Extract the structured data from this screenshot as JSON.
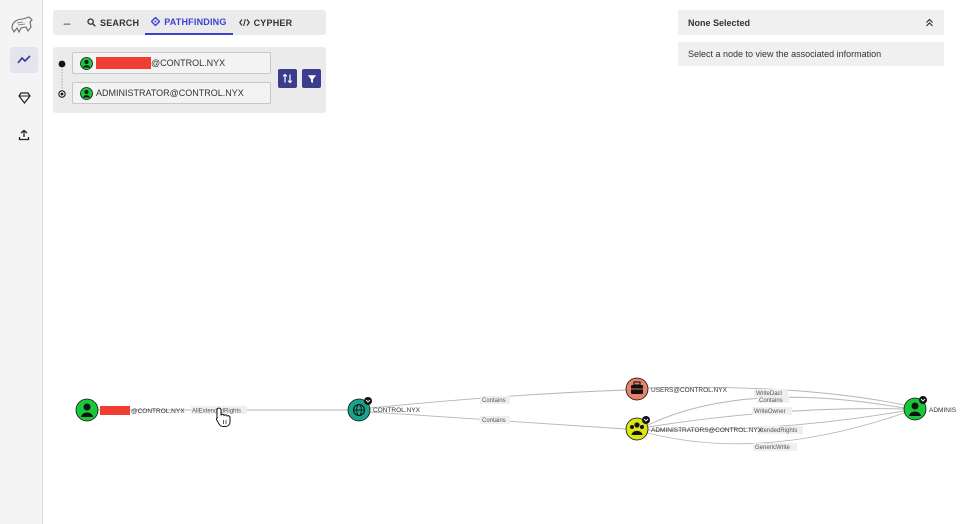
{
  "tabs": {
    "collapse": "–",
    "search": "SEARCH",
    "pathfinding": "PATHFINDING",
    "cypher": "CYPHER"
  },
  "pathfinding": {
    "source_suffix": "@CONTROL.NYX",
    "target_value": "ADMINISTRATOR@CONTROL.NYX"
  },
  "info_panel": {
    "title": "None Selected",
    "message": "Select a node to view the associated information"
  },
  "graph": {
    "nodes": {
      "source_suffix": "@CONTROL.NYX",
      "domain": "CONTROL.NYX",
      "users_group": "USERS@CONTROL.NYX",
      "admins_group": "ADMINISTRATORS@CONTROL.NYX",
      "admin_user": "ADMINIS"
    },
    "edges": {
      "e1": "AllExtendedRights",
      "e2": "Contains",
      "e3": "Contains",
      "e4": "WriteDacl",
      "e5": "Contains",
      "e6": "WriteOwner",
      "e7": "xtendedRights",
      "e8": "GenericWrite"
    }
  },
  "colors": {
    "accent": "#3b3fd6",
    "user_node": "#17c93a",
    "domain_node": "#17a38a",
    "users_group_node": "#e8836b",
    "admins_group_node": "#dbe516",
    "redaction": "#f03e32"
  }
}
